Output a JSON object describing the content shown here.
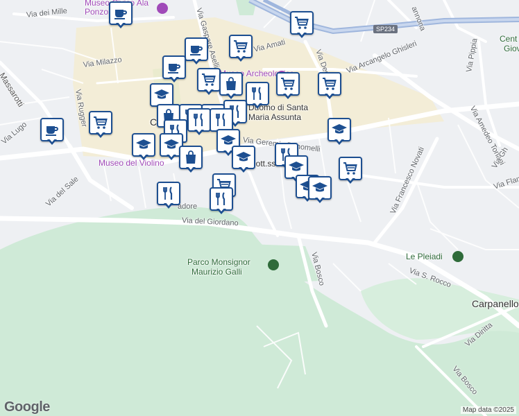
{
  "map": {
    "attribution": "Map data ©2025",
    "logo_text": "Google",
    "colors": {
      "background": "#eef0f3",
      "park": "#cfead7",
      "road": "#ffffff",
      "highway": "#9fb6dd",
      "center_area": "#f6ebc8",
      "marker_border": "#1d4f91",
      "poi_purple": "#a04ab8",
      "park_green": "#2f6b3a"
    }
  },
  "streets": {
    "via_dei_mille": "Via dei Mille",
    "via_milazzo": "Via Milazzo",
    "massarotti": "Massarotti",
    "via_rugger": "Via Rugger",
    "via_lugo": "Via Lugo",
    "via_del_sale": "Via del Sale",
    "via_gaspare_aselli": "Via Gaspare Aselli",
    "via_amati": "Via Amati",
    "via_decia": "Via Decia",
    "via_arcangelo_ghisleri": "Via Arcangelo Ghisleri",
    "via_pippia": "Via Pippia",
    "via_amedeo_tonani": "Via Amedeo Tonani",
    "via_gh": "Via Gh",
    "via_flam": "Via Flam",
    "via_geremia_bonomelli": "Via Geremia Bonomelli",
    "via_francesco_novati": "Via Francesco Novati",
    "sadore": "adore",
    "via_del_giordano": "Via del Giordano",
    "via_bosco_1": "Via Bosco",
    "via_s_rocco": "Via S. Rocco",
    "via_diritta": "Via Diritta",
    "via_bosco_2": "Via Bosco",
    "annona": "annona"
  },
  "places": {
    "museo_civico": "Museo Civico Ala Ponzone",
    "museo_archeologico": "Museo Archeologico",
    "duomo": "Duomo di Santa Maria Assunta",
    "museo_violino": "Museo del Violino",
    "parco_line1": "Parco Monsignor",
    "parco_line2": "Maurizio Galli",
    "le_pleiadi": "Le Pleiadi",
    "carpanello": "Carpanello",
    "centro_1": "Cent",
    "centro_2": "Giov",
    "c_label": "C",
    "dott_label": "Dott.ssa Lucia"
  },
  "road_shield": "SP234",
  "markers": [
    {
      "type": "cafe",
      "icon": "coffee-cup-icon"
    },
    {
      "type": "shop",
      "icon": "shopping-cart-icon"
    },
    {
      "type": "cafe",
      "icon": "coffee-cup-icon"
    },
    {
      "type": "shop",
      "icon": "shopping-cart-icon"
    },
    {
      "type": "cafe",
      "icon": "coffee-cup-icon"
    },
    {
      "type": "shop",
      "icon": "shopping-cart-icon"
    },
    {
      "type": "bag",
      "icon": "shopping-bag-icon"
    },
    {
      "type": "food",
      "icon": "fork-knife-icon"
    },
    {
      "type": "shop",
      "icon": "shopping-cart-icon"
    },
    {
      "type": "shop",
      "icon": "shopping-cart-icon"
    },
    {
      "type": "school",
      "icon": "graduation-cap-icon"
    },
    {
      "type": "food",
      "icon": "fork-knife-icon"
    },
    {
      "type": "bag",
      "icon": "shopping-bag-icon"
    },
    {
      "type": "food",
      "icon": "fork-knife-icon"
    },
    {
      "type": "shop",
      "icon": "shopping-cart-icon"
    },
    {
      "type": "food",
      "icon": "fork-knife-icon"
    },
    {
      "type": "food",
      "icon": "fork-knife-icon"
    },
    {
      "type": "cafe",
      "icon": "coffee-cup-icon"
    },
    {
      "type": "shop",
      "icon": "shopping-cart-icon"
    },
    {
      "type": "school",
      "icon": "graduation-cap-icon"
    },
    {
      "type": "school",
      "icon": "graduation-cap-icon"
    },
    {
      "type": "food",
      "icon": "fork-knife-icon"
    },
    {
      "type": "school",
      "icon": "graduation-cap-icon"
    },
    {
      "type": "bag",
      "icon": "shopping-bag-icon"
    },
    {
      "type": "school",
      "icon": "graduation-cap-icon"
    },
    {
      "type": "school",
      "icon": "graduation-cap-icon"
    },
    {
      "type": "food",
      "icon": "fork-knife-icon"
    },
    {
      "type": "school",
      "icon": "graduation-cap-icon"
    },
    {
      "type": "shop",
      "icon": "shopping-cart-icon"
    },
    {
      "type": "school",
      "icon": "graduation-cap-icon"
    },
    {
      "type": "school",
      "icon": "graduation-cap-icon"
    },
    {
      "type": "shop",
      "icon": "shopping-cart-icon"
    },
    {
      "type": "food",
      "icon": "fork-knife-icon"
    },
    {
      "type": "food",
      "icon": "fork-knife-icon"
    }
  ]
}
